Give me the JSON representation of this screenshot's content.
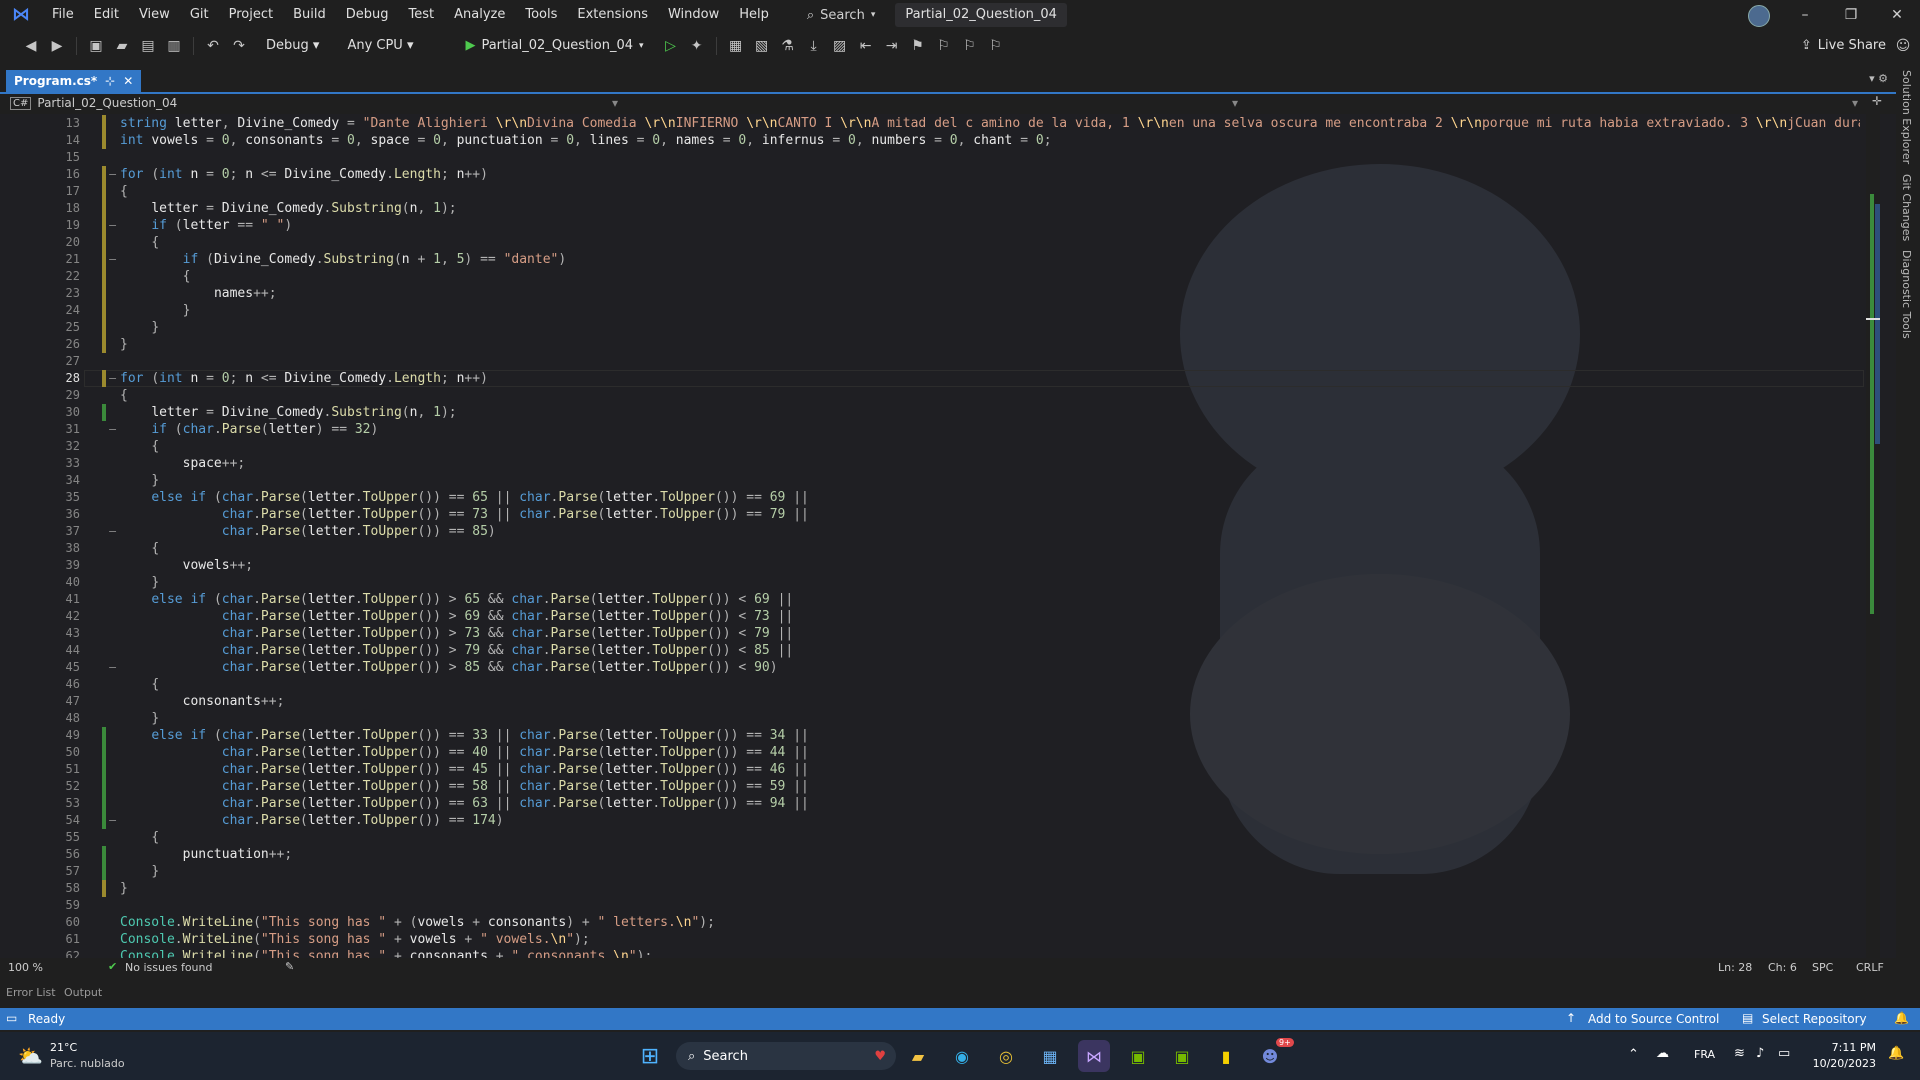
{
  "menu": [
    "File",
    "Edit",
    "View",
    "Git",
    "Project",
    "Build",
    "Debug",
    "Test",
    "Analyze",
    "Tools",
    "Extensions",
    "Window",
    "Help"
  ],
  "search_label": "Search",
  "solution_title": "Partial_02_Question_04",
  "toolbar": {
    "config": "Debug",
    "platform": "Any CPU",
    "run_target": "Partial_02_Question_04",
    "live_share": "Live Share"
  },
  "tab": {
    "name": "Program.cs*",
    "pin": "⊹",
    "close": "✕"
  },
  "navbar": {
    "project": "Partial_02_Question_04"
  },
  "current_line": 28,
  "lines": [
    {
      "n": 13,
      "code": "string letter, Divine_Comedy = \"Dante Alighieri \\r\\nDivina Comedia \\r\\nINFIERNO \\r\\nCANTO I \\r\\nA mitad del c amino de la vida, 1 \\r\\nen una selva oscura me encontraba 2 \\r\\nporque mi ruta habia extraviado. 3 \\r\\njCuan dura cosa"
    },
    {
      "n": 14,
      "code": "int vowels = 0, consonants = 0, space = 0, punctuation = 0, lines = 0, names = 0, infernus = 0, numbers = 0, chant = 0;"
    },
    {
      "n": 15,
      "code": ""
    },
    {
      "n": 16,
      "code": "for (int n = 0; n <= Divine_Comedy.Length; n++)"
    },
    {
      "n": 17,
      "code": "{"
    },
    {
      "n": 18,
      "code": "    letter = Divine_Comedy.Substring(n, 1);"
    },
    {
      "n": 19,
      "code": "    if (letter == \" \")"
    },
    {
      "n": 20,
      "code": "    {"
    },
    {
      "n": 21,
      "code": "        if (Divine_Comedy.Substring(n + 1, 5) == \"dante\")"
    },
    {
      "n": 22,
      "code": "        {"
    },
    {
      "n": 23,
      "code": "            names++;"
    },
    {
      "n": 24,
      "code": "        }"
    },
    {
      "n": 25,
      "code": "    }"
    },
    {
      "n": 26,
      "code": "}"
    },
    {
      "n": 27,
      "code": ""
    },
    {
      "n": 28,
      "code": "for (int n = 0; n <= Divine_Comedy.Length; n++)"
    },
    {
      "n": 29,
      "code": "{"
    },
    {
      "n": 30,
      "code": "    letter = Divine_Comedy.Substring(n, 1);"
    },
    {
      "n": 31,
      "code": "    if (char.Parse(letter) == 32)"
    },
    {
      "n": 32,
      "code": "    {"
    },
    {
      "n": 33,
      "code": "        space++;"
    },
    {
      "n": 34,
      "code": "    }"
    },
    {
      "n": 35,
      "code": "    else if (char.Parse(letter.ToUpper()) == 65 || char.Parse(letter.ToUpper()) == 69 ||"
    },
    {
      "n": 36,
      "code": "             char.Parse(letter.ToUpper()) == 73 || char.Parse(letter.ToUpper()) == 79 ||"
    },
    {
      "n": 37,
      "code": "             char.Parse(letter.ToUpper()) == 85)"
    },
    {
      "n": 38,
      "code": "    {"
    },
    {
      "n": 39,
      "code": "        vowels++;"
    },
    {
      "n": 40,
      "code": "    }"
    },
    {
      "n": 41,
      "code": "    else if (char.Parse(letter.ToUpper()) > 65 && char.Parse(letter.ToUpper()) < 69 ||"
    },
    {
      "n": 42,
      "code": "             char.Parse(letter.ToUpper()) > 69 && char.Parse(letter.ToUpper()) < 73 ||"
    },
    {
      "n": 43,
      "code": "             char.Parse(letter.ToUpper()) > 73 && char.Parse(letter.ToUpper()) < 79 ||"
    },
    {
      "n": 44,
      "code": "             char.Parse(letter.ToUpper()) > 79 && char.Parse(letter.ToUpper()) < 85 ||"
    },
    {
      "n": 45,
      "code": "             char.Parse(letter.ToUpper()) > 85 && char.Parse(letter.ToUpper()) < 90)"
    },
    {
      "n": 46,
      "code": "    {"
    },
    {
      "n": 47,
      "code": "        consonants++;"
    },
    {
      "n": 48,
      "code": "    }"
    },
    {
      "n": 49,
      "code": "    else if (char.Parse(letter.ToUpper()) == 33 || char.Parse(letter.ToUpper()) == 34 ||"
    },
    {
      "n": 50,
      "code": "             char.Parse(letter.ToUpper()) == 40 || char.Parse(letter.ToUpper()) == 44 ||"
    },
    {
      "n": 51,
      "code": "             char.Parse(letter.ToUpper()) == 45 || char.Parse(letter.ToUpper()) == 46 ||"
    },
    {
      "n": 52,
      "code": "             char.Parse(letter.ToUpper()) == 58 || char.Parse(letter.ToUpper()) == 59 ||"
    },
    {
      "n": 53,
      "code": "             char.Parse(letter.ToUpper()) == 63 || char.Parse(letter.ToUpper()) == 94 ||"
    },
    {
      "n": 54,
      "code": "             char.Parse(letter.ToUpper()) == 174)"
    },
    {
      "n": 55,
      "code": "    {"
    },
    {
      "n": 56,
      "code": "        punctuation++;"
    },
    {
      "n": 57,
      "code": "    }"
    },
    {
      "n": 58,
      "code": "}"
    },
    {
      "n": 59,
      "code": ""
    },
    {
      "n": 60,
      "code": "Console.WriteLine(\"This song has \" + (vowels + consonants) + \" letters.\\n\");"
    },
    {
      "n": 61,
      "code": "Console.WriteLine(\"This song has \" + vowels + \" vowels.\\n\");"
    },
    {
      "n": 62,
      "code": "Console.WriteLine(\"This song has \" + consonants + \" consonants.\\n\");"
    }
  ],
  "markers": {
    "green": [
      30,
      49,
      50,
      51,
      52,
      53,
      54,
      56,
      57
    ],
    "yellow": [
      13,
      14,
      16,
      17,
      18,
      19,
      20,
      21,
      22,
      23,
      24,
      25,
      26,
      28,
      58
    ]
  },
  "folds": [
    16,
    19,
    21,
    28,
    31,
    37,
    45,
    54
  ],
  "editor_status": {
    "zoom": "100 %",
    "issues": "No issues found",
    "ln": "Ln: 28",
    "ch": "Ch: 6",
    "spc": "SPC",
    "crlf": "CRLF"
  },
  "panels": [
    "Error List",
    "Output"
  ],
  "statusbar": {
    "ready": "Ready",
    "add_source": "Add to Source Control",
    "select_repo": "Select Repository"
  },
  "side_tabs": [
    "Solution Explorer",
    "Git Changes",
    "Diagnostic Tools"
  ],
  "taskbar": {
    "temp": "21°C",
    "weather": "Parc. nublado",
    "search": "Search",
    "lang": "FRA",
    "time": "7:11 PM",
    "date": "10/20/2023",
    "discord_badge": "9+"
  },
  "colors": {
    "accent": "#3277c6",
    "keyword": "#569cd6",
    "type": "#4ec9b0",
    "string": "#d69d85",
    "number": "#b5cea8",
    "method": "#dcdcaa"
  }
}
